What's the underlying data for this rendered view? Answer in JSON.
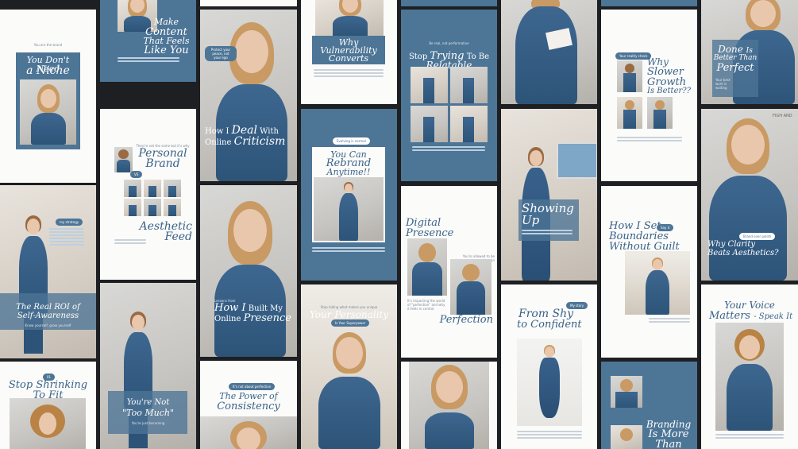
{
  "colors": {
    "background": "#1d1f22",
    "accent": "#4d7596",
    "title": "#3a6288",
    "card_white": "#fbfbfa"
  },
  "cards": {
    "c1": {
      "eyebrow": "You are the brand",
      "title_1": "You Don't Need",
      "title_2": "a Niche"
    },
    "c2": {
      "title_1": "Make",
      "title_2": "Content",
      "title_3": "That Feels",
      "title_4": "Like You"
    },
    "c3": {
      "bubble": "Protect your peace, not your ego",
      "title_1": "How I",
      "title_1b": "Deal",
      "title_1c": "With",
      "title_2": "Online",
      "title_2b": "Criticism"
    },
    "c4": {
      "title_1": "Why",
      "title_2": "Vulnerability",
      "title_3": "Converts"
    },
    "c5": {
      "eyebrow": "Be real, not performative",
      "title_1": "Stop",
      "title_1b": "Trying",
      "title_1c": "To Be",
      "title_2": "Relatable"
    },
    "c7": {
      "pill": "Your reality check",
      "title_1": "Why",
      "title_2": "Slower",
      "title_3": "Growth",
      "title_4": "Is Better??"
    },
    "c8": {
      "title_1": "Done",
      "title_1b": "Is",
      "title_2": "Better Than",
      "title_3": "Perfect",
      "sub": "Your best work is waiting"
    },
    "c9": {
      "eyebrow": "They're not the same but it's why",
      "title_1": "Personal",
      "title_2": "Brand",
      "vs": "VS",
      "title_3": "Aesthetic",
      "title_4": "Feed"
    },
    "c11": {
      "pill": "Evolving is normal",
      "title_1": "You Can",
      "title_2": "Rebrand",
      "title_3": "Anytime!!"
    },
    "c12": {
      "title_1": "Showing",
      "title_2": "Up"
    },
    "c14": {
      "pill": "Say it",
      "title_1": "How I Set",
      "title_2": "Boundaries",
      "title_3": "Without Guilt"
    },
    "c15": {
      "bubble": "Brand over polish",
      "title_1": "Why Clarity",
      "title_2": "Beats Aesthetics?",
      "board": "FIGH AND"
    },
    "c16": {
      "pill": "my strategy",
      "title_1": "The Real ROI of",
      "title_2": "Self-Awareness",
      "sub": "Know yourself, grow yourself"
    },
    "c17": {
      "title_1": "You're Not",
      "title_2": "\"Too Much\"",
      "sub": "You're just becoming"
    },
    "c18": {
      "eyebrow": "Lessons from",
      "title_1": "How I",
      "title_1b": "Built My",
      "title_2": "Online",
      "title_2b": "Presence"
    },
    "c19": {
      "eyebrow": "Stop hiding what makes you unique",
      "title": "Your Personality",
      "pill": "Is Your Superpower"
    },
    "c20": {
      "title_1": "Digital",
      "title_2": "Presence",
      "caption": "It's impacting the world of \"perfection\" and why it feels in control",
      "side": "You're allowed to be human",
      "title_3": "Perfection"
    },
    "c21": {
      "pill": "My story",
      "title_1": "From Shy",
      "title_2": "to Confident"
    },
    "c22": {
      "title_1": "Your Voice",
      "title_2": "Matters",
      "title_2b": "- Speak It"
    },
    "c23": {
      "pill": "01",
      "title_1": "Stop Shrinking",
      "title_2": "To Fit"
    },
    "c24": {
      "pill": "It's not about perfection",
      "title_1": "The Power of",
      "title_2": "Consistency"
    },
    "c25": {
      "title_1": "Branding",
      "title_2": "Is More",
      "title_3": "Than"
    }
  }
}
